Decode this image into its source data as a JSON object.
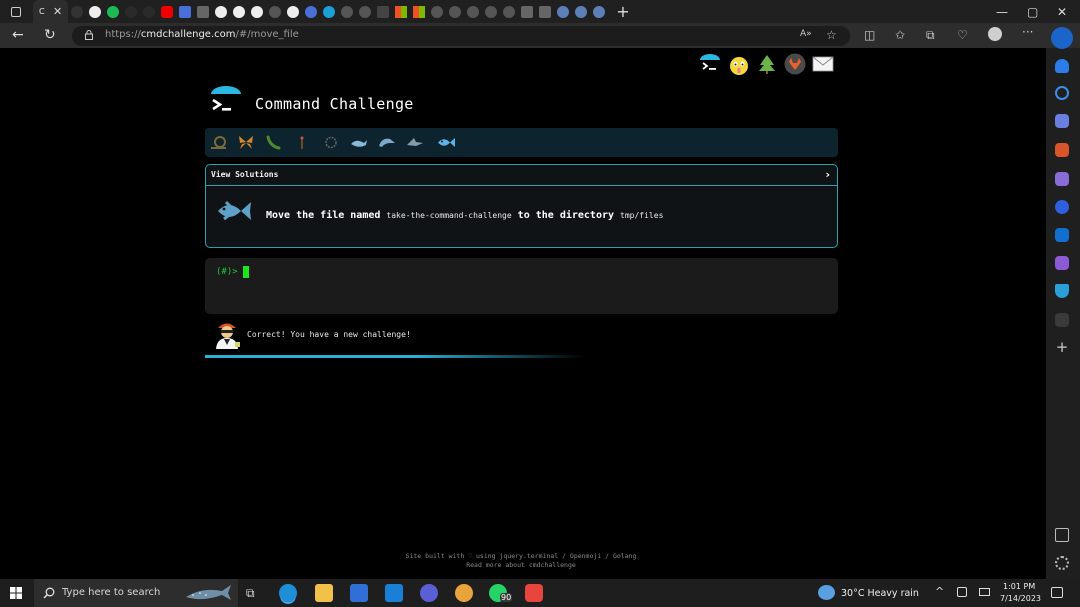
{
  "browser": {
    "active_tab_label": "C",
    "address": {
      "prefix": "https://",
      "host": "cmdchallenge.com",
      "path": "/#/move_file"
    },
    "colors": {
      "tabstrip": "#202020",
      "toolbar": "#2d2d2d"
    }
  },
  "page": {
    "brand_title": "Command Challenge",
    "view_solutions_label": "View Solutions",
    "task": {
      "lead": "Move the file named ",
      "filename": "take-the-command-challenge",
      "middle": " to the directory ",
      "directory": "tmp/files"
    },
    "terminal": {
      "prompt": "(#)>"
    },
    "status_message": "Correct! You have a new challenge!",
    "footer": {
      "line1": "Site built with ♡ using jquery.terminal / Openmoji / Golang",
      "line2": "Read more about cmdchallenge"
    },
    "colors": {
      "accent": "#2c9fb0",
      "prompt": "#22c83a",
      "cursor": "#1fe51f",
      "level_bar": "#0d232d"
    }
  },
  "taskbar": {
    "search_placeholder": "Type here to search",
    "whatsapp_badge": "90",
    "weather": "30°C  Heavy rain",
    "time": "1:01 PM",
    "date": "7/14/2023"
  }
}
